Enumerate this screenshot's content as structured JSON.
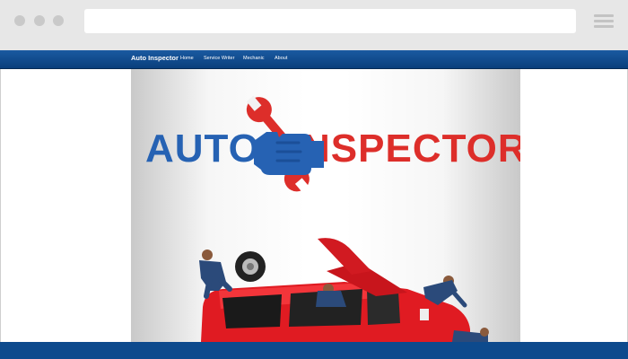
{
  "nav": {
    "brand": "Auto Inspector",
    "links": [
      "Home",
      "Service Writer",
      "Mechanic",
      "About"
    ]
  },
  "hero": {
    "logo": {
      "left": "AUTO",
      "right": "NSPECTOR"
    },
    "scene": "car-repair-illustration"
  },
  "colors": {
    "nav_bar": "#0a3f7c",
    "logo_blue": "#2662b3",
    "logo_red": "#dd2e2a",
    "footer_bar": "#0d4a8d"
  }
}
